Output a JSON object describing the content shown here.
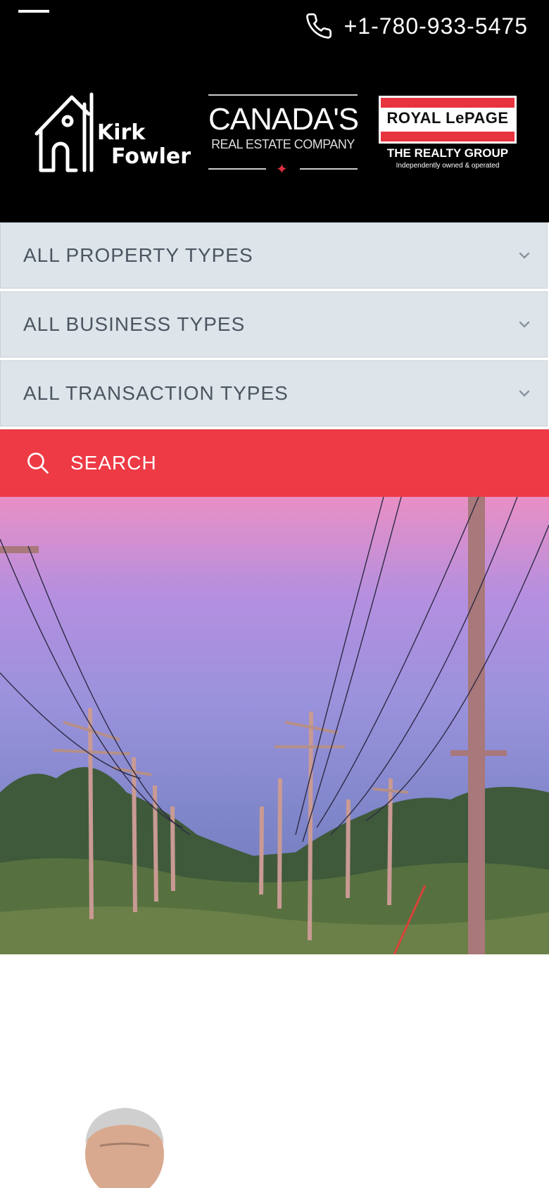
{
  "header": {
    "phone": "+1-780-933-5475",
    "logo_name_line1": "Kirk",
    "logo_name_line2": "Fowler",
    "canada_big": "CANADA'S",
    "canada_small": "REAL ESTATE COMPANY",
    "rlp_brand": "ROYAL LePAGE",
    "rlp_group": "THE REALTY GROUP",
    "rlp_tagline": "Independently owned & operated"
  },
  "filters": [
    {
      "label": "ALL PROPERTY TYPES"
    },
    {
      "label": "ALL BUSINESS TYPES"
    },
    {
      "label": "ALL TRANSACTION TYPES"
    }
  ],
  "search": {
    "label": "SEARCH"
  },
  "colors": {
    "header_bg": "#000000",
    "filter_bg": "#dde4ea",
    "search_bg": "#ed3a45",
    "accent_red": "#e8343f"
  },
  "icons": {
    "menu": "hamburger-icon",
    "phone": "phone-icon",
    "chevron": "chevron-down-icon",
    "search": "search-icon"
  }
}
